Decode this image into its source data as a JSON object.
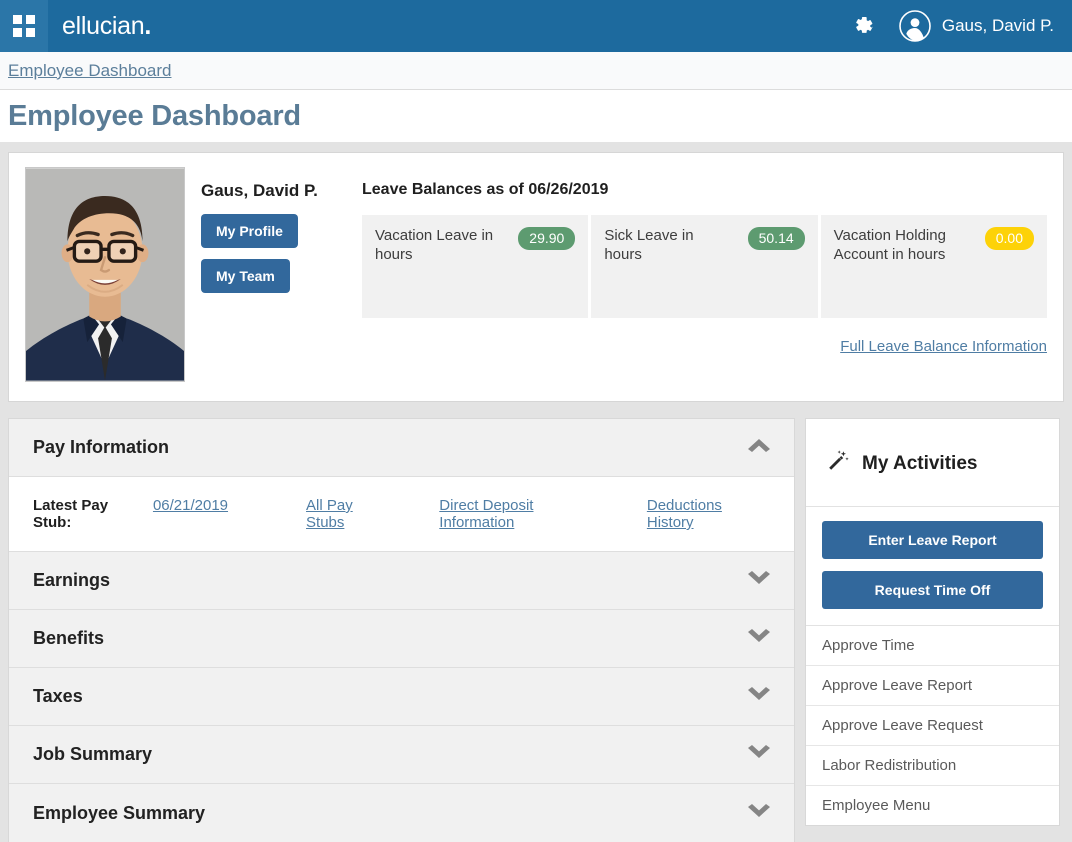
{
  "topbar": {
    "menu_icon": "grid-apps-icon",
    "brand": "ellucian",
    "brand_dot": ".",
    "settings_icon": "gear-icon",
    "avatar_icon": "user-avatar-icon",
    "user_name": "Gaus, David P.",
    "background_color": "#1d6a9e"
  },
  "breadcrumb": {
    "link": "Employee Dashboard"
  },
  "header": {
    "page_title": "Employee Dashboard",
    "title_color": "#5a7c96"
  },
  "profile": {
    "photo_alt": "employee-portrait",
    "employee_name": "Gaus, David P.",
    "my_profile_label": "My Profile",
    "my_team_label": "My Team",
    "button_color": "#32689c"
  },
  "leave": {
    "heading": "Leave Balances as of 06/26/2019",
    "cards": [
      {
        "label": "Vacation Leave in hours",
        "value": "29.90",
        "badge_style": "green",
        "badge_color": "#5d9b70"
      },
      {
        "label": "Sick Leave in hours",
        "value": "50.14",
        "badge_style": "green",
        "badge_color": "#5d9b70"
      },
      {
        "label": "Vacation Holding Account in hours",
        "value": "0.00",
        "badge_style": "yellow",
        "badge_color": "#fdd208"
      }
    ],
    "full_info_link": "Full Leave Balance Information"
  },
  "pay_information": {
    "title": "Pay Information",
    "expanded": true,
    "chevron_icon": "chevron-up-icon",
    "latest_pay_stub_label": "Latest Pay Stub:",
    "latest_pay_stub_date": "06/21/2019",
    "links": [
      "All Pay Stubs",
      "Direct Deposit Information",
      "Deductions History"
    ]
  },
  "accordions": [
    {
      "title": "Earnings",
      "chevron_icon": "chevron-down-icon"
    },
    {
      "title": "Benefits",
      "chevron_icon": "chevron-down-icon"
    },
    {
      "title": "Taxes",
      "chevron_icon": "chevron-down-icon"
    },
    {
      "title": "Job Summary",
      "chevron_icon": "chevron-down-icon"
    },
    {
      "title": "Employee Summary",
      "chevron_icon": "chevron-down-icon"
    }
  ],
  "my_activities": {
    "icon": "magic-wand-icon",
    "title": "My Activities",
    "buttons": [
      "Enter Leave Report",
      "Request Time Off"
    ],
    "links": [
      "Approve Time",
      "Approve Leave Report",
      "Approve Leave Request",
      "Labor Redistribution",
      "Employee Menu"
    ]
  }
}
